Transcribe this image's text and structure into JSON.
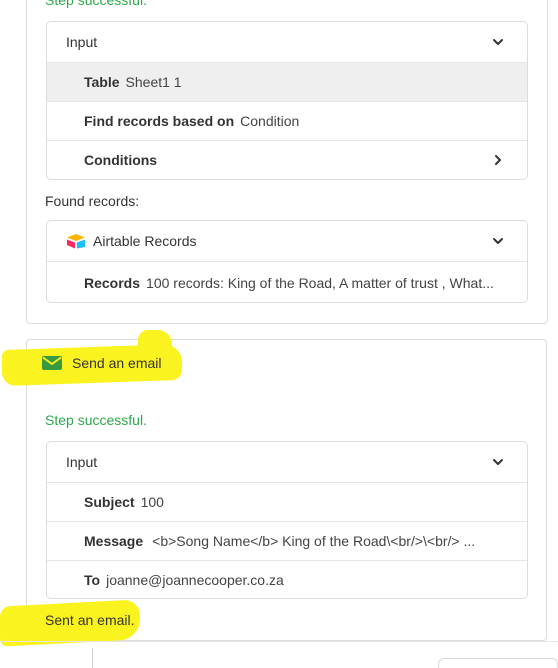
{
  "top_step": {
    "status_clipped": "Step successful.",
    "input_panel": {
      "header": "Input",
      "rows": [
        {
          "key": "Table",
          "value": "Sheet1 1"
        },
        {
          "key": "Find records based on",
          "value": "Condition"
        },
        {
          "key": "Conditions",
          "value": ""
        }
      ]
    },
    "found_label": "Found records:",
    "records_panel": {
      "header": "Airtable Records",
      "rows": [
        {
          "key": "Records",
          "value": "100 records: King of the Road, A matter of trust , What..."
        }
      ]
    }
  },
  "email_step": {
    "title": "Send an email",
    "status": "Step successful.",
    "input_panel": {
      "header": "Input",
      "rows": [
        {
          "key": "Subject",
          "value": "100"
        },
        {
          "key": "Message",
          "value": "<b>Song Name</b> King of the Road\\<br/>\\<br/> ..."
        },
        {
          "key": "To",
          "value": "joanne@joannecooper.co.za"
        }
      ]
    },
    "result": "Sent an email."
  },
  "colors": {
    "success_green": "#2ca84b",
    "highlight_yellow": "#fbf31f",
    "email_icon_green": "#3a9a3f"
  },
  "icons": [
    "chevron-down-icon",
    "chevron-right-icon",
    "airtable-logo-icon",
    "email-icon"
  ]
}
